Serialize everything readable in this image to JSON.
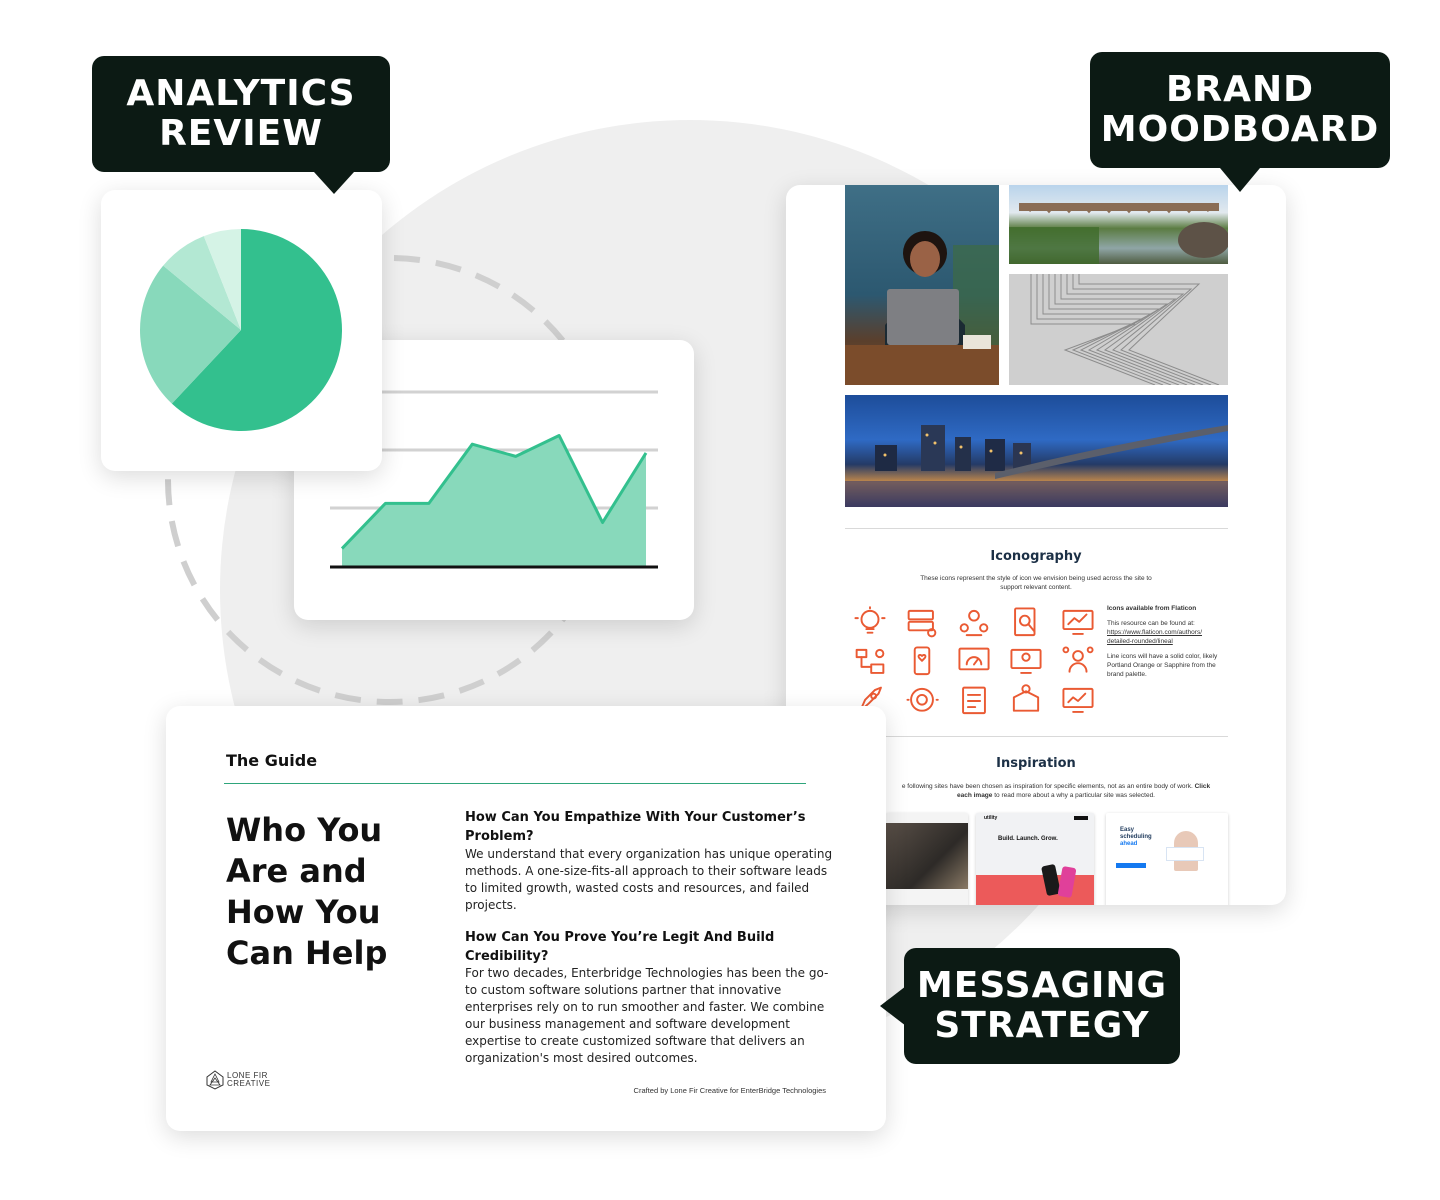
{
  "callouts": {
    "analytics": [
      "ANALYTICS",
      "REVIEW"
    ],
    "brand": [
      "BRAND",
      "MOODBOARD"
    ],
    "messaging": [
      "MESSAGING",
      "STRATEGY"
    ]
  },
  "colors": {
    "callout_bg": "#0c1a14",
    "chart_green_dark": "#33c08e",
    "chart_green_mid": "#88d9bb",
    "chart_green_light": "#b3e8d3",
    "chart_green_pale": "#d5f3e6",
    "icon_orange": "#ea5a33",
    "heading_navy": "#1c3046"
  },
  "chart_data": [
    {
      "type": "pie",
      "values": [
        62,
        24,
        8,
        6
      ]
    },
    {
      "type": "area",
      "x": [
        1,
        2,
        3,
        4,
        5,
        6,
        7,
        8,
        9
      ],
      "values": [
        10,
        36,
        36,
        70,
        63,
        75,
        25,
        65
      ]
    }
  ],
  "moodboard": {
    "iconography": {
      "heading": "Iconography",
      "intro": [
        "These icons represent the style of icon we envision being used across the site to",
        "support relevant content."
      ],
      "source_title": "Icons available from Flaticon",
      "source_text": "This resource can be found at:",
      "source_link": [
        "https://www.flaticon.com/authors/",
        "detailed-rounded/lineal"
      ],
      "color_note": [
        "Line icons will have a solid color, likely",
        "Portland Orange or Sapphire from the",
        "brand palette."
      ],
      "icons": [
        "lightbulb-icon",
        "code-settings-icon",
        "team-icon",
        "document-search-icon",
        "analytics-monitor-icon",
        "workflow-icon",
        "mobile-heart-icon",
        "dashboard-icon",
        "monitor-idea-icon",
        "user-network-icon",
        "rocket-icon",
        "gear-cycle-icon",
        "checklist-icon",
        "box-settings-icon",
        "chart-monitor-icon"
      ]
    },
    "inspiration": {
      "heading": "Inspiration",
      "intro_line1": "e following sites have been chosen as inspiration for specific elements, not as an entire body of work.",
      "intro_click": "Click",
      "intro_bold2": "each image",
      "intro_line2": " to read more about a why a particular site was selected.",
      "thumb2_brand": "utility",
      "thumb2_headline": "Build. Launch. Grow.",
      "thumb3_headline": [
        "Easy",
        "scheduling",
        "ahead"
      ]
    }
  },
  "guide": {
    "label": "The Guide",
    "title": "Who You Are and How You Can Help",
    "q1": "How Can You Empathize With Your Customer’s Problem?",
    "a1": "We understand that every organization has unique operating methods. A one-size-fits-all approach to their software leads to limited growth, wasted costs and resources, and failed projects.",
    "q2": "How Can You Prove You’re Legit And Build Credibility?",
    "a2": "For two decades, Enterbridge Technologies has been the go-to custom software solutions partner that innovative enterprises rely on to run smoother and faster. We combine our business management and software development expertise to create customized software that delivers an organization's most desired outcomes.",
    "logo": [
      "LONE FIR",
      "CREATIVE"
    ],
    "footer": "Crafted by Lone Fir Creative for EnterBridge Technologies"
  }
}
